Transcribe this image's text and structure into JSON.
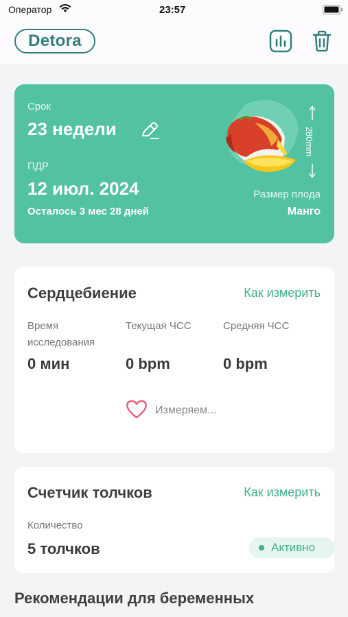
{
  "status_bar": {
    "carrier": "Оператор",
    "time": "23:57"
  },
  "header": {
    "logo_text": "Detora",
    "stats_icon": "bar-chart-icon",
    "trash_icon": "trash-icon"
  },
  "term_card": {
    "term_label": "Срок",
    "term_value": "23 недели",
    "due_label": "ПДР",
    "due_value": "12 июл. 2024",
    "remaining": "Осталось 3 мес 28 дней",
    "fruit_size": "280mm",
    "fruit_size_label": "Размер плода",
    "fruit_name": "Манго",
    "accent_color": "#52c2a0"
  },
  "heartbeat": {
    "title": "Сердцебиение",
    "how_to_link": "Как измерить",
    "stats": [
      {
        "label_line1": "Время",
        "label_line2": "исследования",
        "value": "0 мин"
      },
      {
        "label_line1": "Текущая ЧСС",
        "label_line2": "",
        "value": "0 bpm"
      },
      {
        "label_line1": "Средняя ЧСС",
        "label_line2": "",
        "value": "0 bpm"
      }
    ],
    "status_text": "Измеряем..."
  },
  "kick_counter": {
    "title": "Счетчик толчков",
    "how_to_link": "Как измерить",
    "count_label": "Количество",
    "count_value": "5 толчков",
    "status_badge": "Активно"
  },
  "recommendations": {
    "title": "Рекомендации для беременных"
  }
}
